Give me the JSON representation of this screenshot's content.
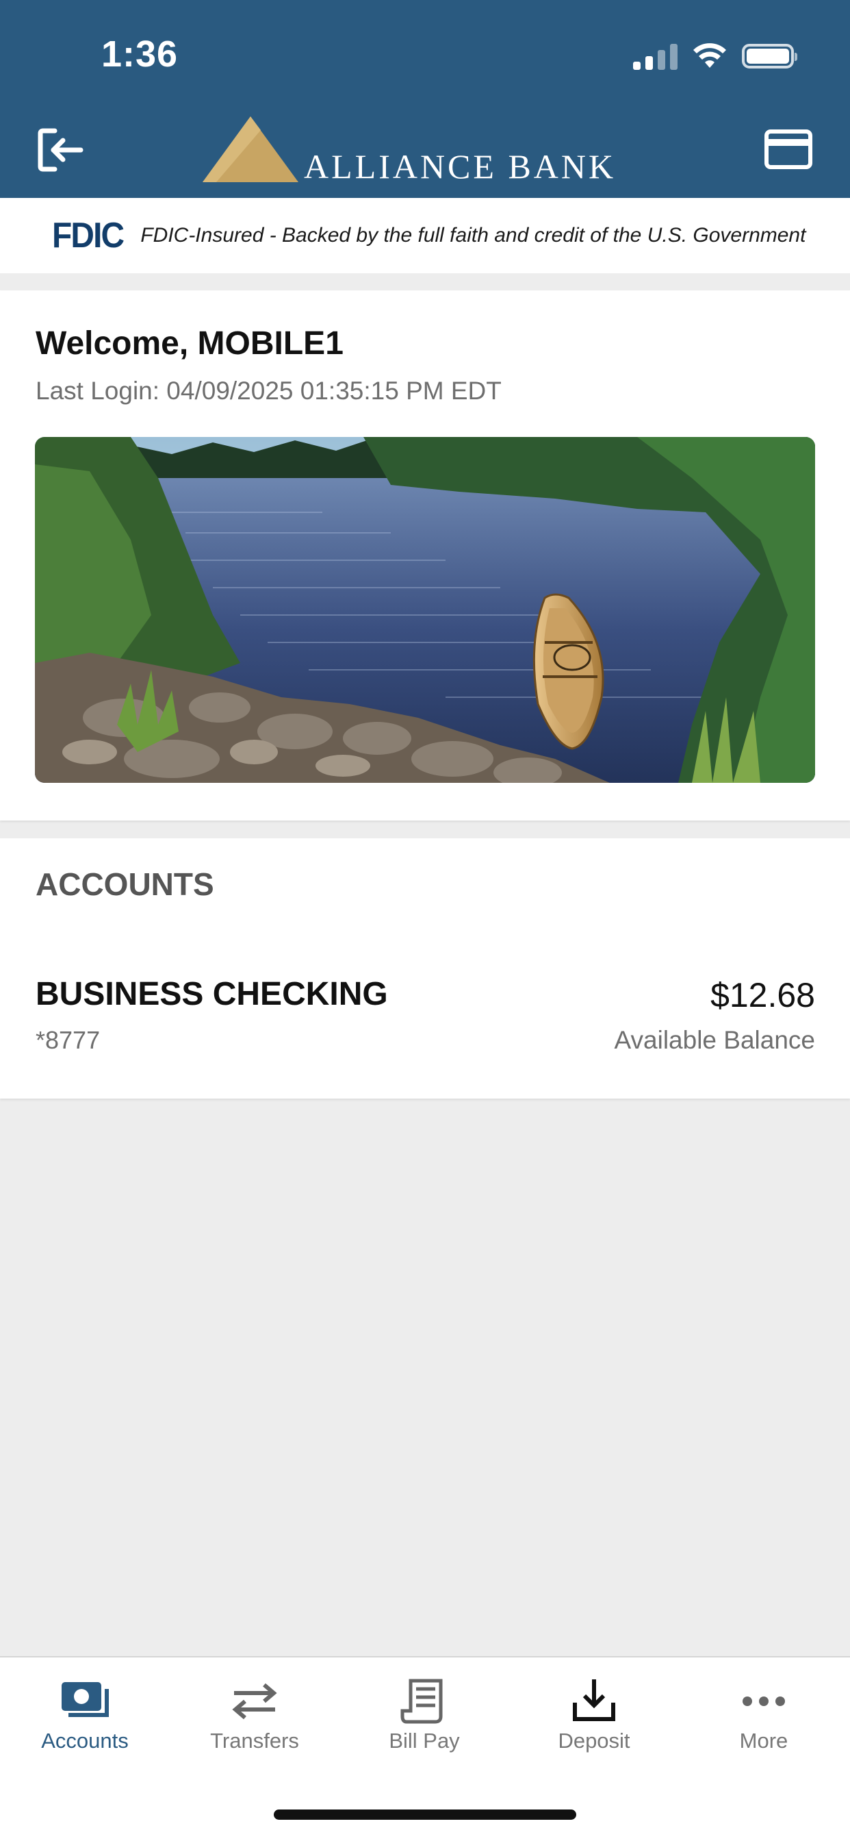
{
  "status_bar": {
    "time": "1:36"
  },
  "header": {
    "logo_text": "ALLIANCE BANK",
    "logout_icon": "logout-icon",
    "card_icon": "credit-card-icon",
    "background_color": "#2a5a80",
    "logo_color": "#c8a563"
  },
  "fdic": {
    "logo": "FDIC",
    "text": "FDIC-Insured - Backed by the full faith and credit of the U.S. Government"
  },
  "welcome": {
    "title": "Welcome, MOBILE1",
    "last_login": "Last Login: 04/09/2025 01:35:15 PM EDT"
  },
  "accounts": {
    "heading": "ACCOUNTS",
    "items": [
      {
        "name": "BUSINESS CHECKING",
        "number": "*8777",
        "balance": "$12.68",
        "balance_label": "Available Balance"
      }
    ]
  },
  "tabbar": {
    "active_color": "#2b5b82",
    "tabs": [
      {
        "label": "Accounts",
        "icon": "accounts-icon",
        "active": true
      },
      {
        "label": "Transfers",
        "icon": "transfers-icon",
        "active": false
      },
      {
        "label": "Bill Pay",
        "icon": "bill-pay-icon",
        "active": false
      },
      {
        "label": "Deposit",
        "icon": "deposit-icon",
        "active": false
      },
      {
        "label": "More",
        "icon": "more-icon",
        "active": false
      }
    ]
  }
}
